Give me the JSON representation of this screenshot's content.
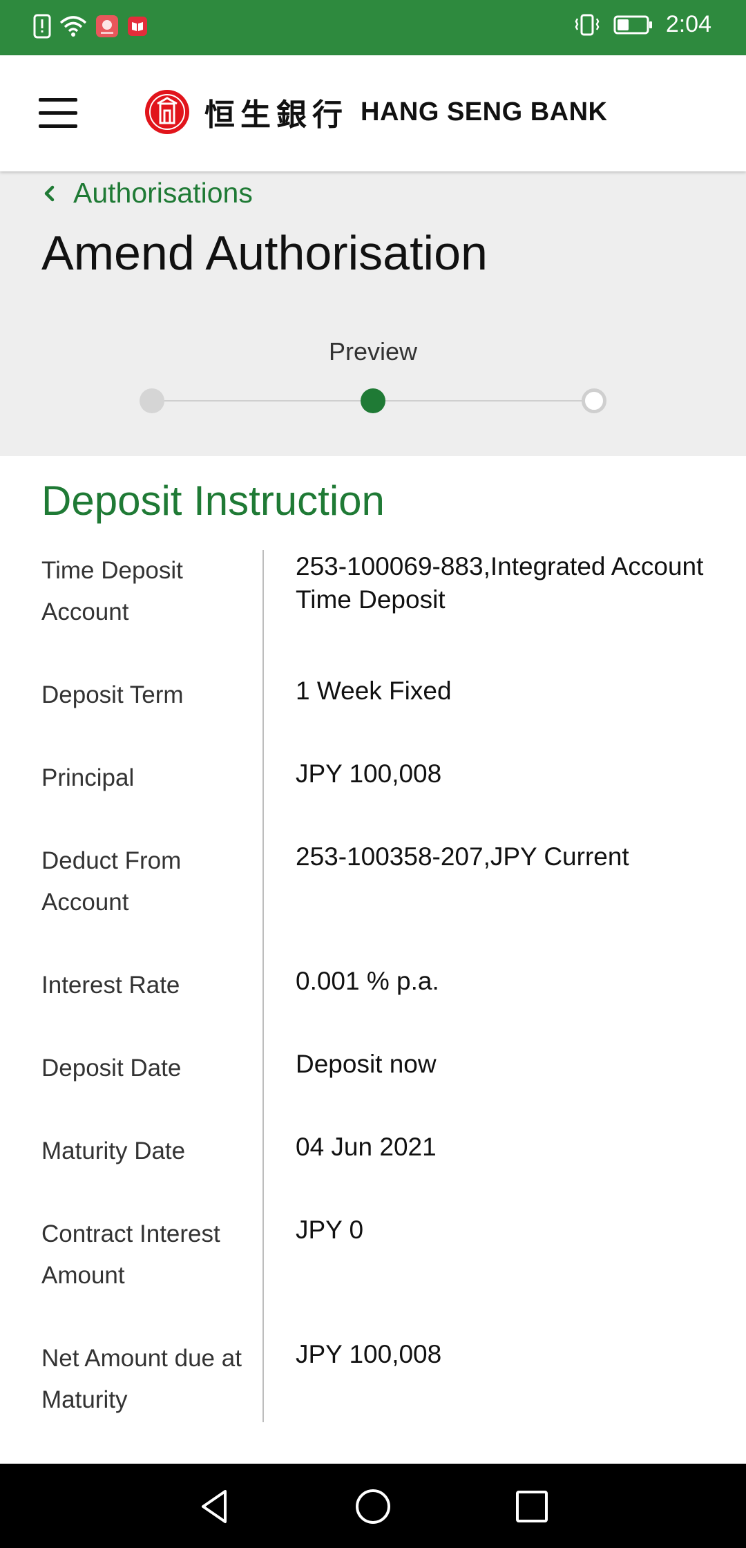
{
  "status_bar": {
    "time": "2:04",
    "icons": [
      "alert-icon",
      "wifi-icon",
      "huawei-app-icon",
      "book-app-icon",
      "vibrate-icon",
      "battery-icon"
    ],
    "background_color": "#2e8a3e"
  },
  "header": {
    "logo_cn": "恒生銀行",
    "logo_en": "HANG SENG BANK",
    "menu_icon": "hamburger-menu-icon",
    "logo_color": "#e1141b"
  },
  "breadcrumb": {
    "label": "Authorisations",
    "icon": "chevron-left-icon"
  },
  "page": {
    "title": "Amend Authorisation"
  },
  "stepper": {
    "current_label": "Preview",
    "total_steps": 3,
    "current_step": 2
  },
  "section": {
    "title": "Deposit Instruction",
    "rows": [
      {
        "label": "Time Deposit Account",
        "value": "253-100069-883,Integrated Account Time Deposit"
      },
      {
        "label": "Deposit Term",
        "value": "1 Week Fixed"
      },
      {
        "label": "Principal",
        "value": "JPY 100,008"
      },
      {
        "label": "Deduct From Account",
        "value": "253-100358-207,JPY Current"
      },
      {
        "label": "Interest Rate",
        "value": "0.001 % p.a."
      },
      {
        "label": "Deposit Date",
        "value": "Deposit now"
      },
      {
        "label": "Maturity Date",
        "value": "04 Jun 2021"
      },
      {
        "label": "Contract Interest Amount",
        "value": "JPY 0"
      },
      {
        "label": "Net Amount due at Maturity",
        "value": "JPY 100,008"
      }
    ]
  },
  "nav_bar": {
    "buttons": [
      "back-icon",
      "home-icon",
      "recents-icon"
    ]
  },
  "colors": {
    "accent": "#1f7a35",
    "gray_bg": "#eeeeee"
  }
}
